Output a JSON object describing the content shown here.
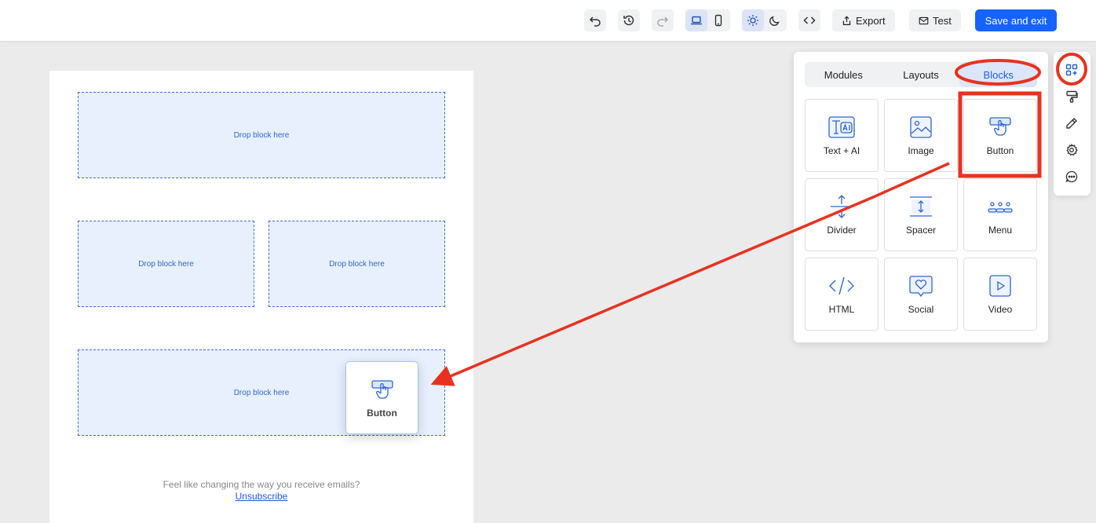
{
  "toolbar": {
    "export_label": "Export",
    "test_label": "Test",
    "save_exit_label": "Save and exit"
  },
  "canvas": {
    "drop_label": "Drop block here",
    "footer_text": "Feel like changing the way you receive emails?",
    "unsubscribe_label": "Unsubscribe"
  },
  "drag_ghost": {
    "label": "Button"
  },
  "panel": {
    "tabs": [
      {
        "label": "Modules"
      },
      {
        "label": "Layouts"
      },
      {
        "label": "Blocks"
      }
    ],
    "tiles": [
      {
        "label": "Text + AI",
        "icon": "text-ai-icon"
      },
      {
        "label": "Image",
        "icon": "image-icon"
      },
      {
        "label": "Button",
        "icon": "button-block-icon"
      },
      {
        "label": "Divider",
        "icon": "divider-icon"
      },
      {
        "label": "Spacer",
        "icon": "spacer-icon"
      },
      {
        "label": "Menu",
        "icon": "menu-icon"
      },
      {
        "label": "HTML",
        "icon": "html-icon"
      },
      {
        "label": "Social",
        "icon": "social-icon"
      },
      {
        "label": "Video",
        "icon": "video-icon"
      }
    ]
  },
  "colors": {
    "primary": "#1463ff",
    "drop_zone_bg": "#e8f0fe",
    "drop_zone_border": "#3b6fd4",
    "annotation_red": "#e8321f"
  }
}
